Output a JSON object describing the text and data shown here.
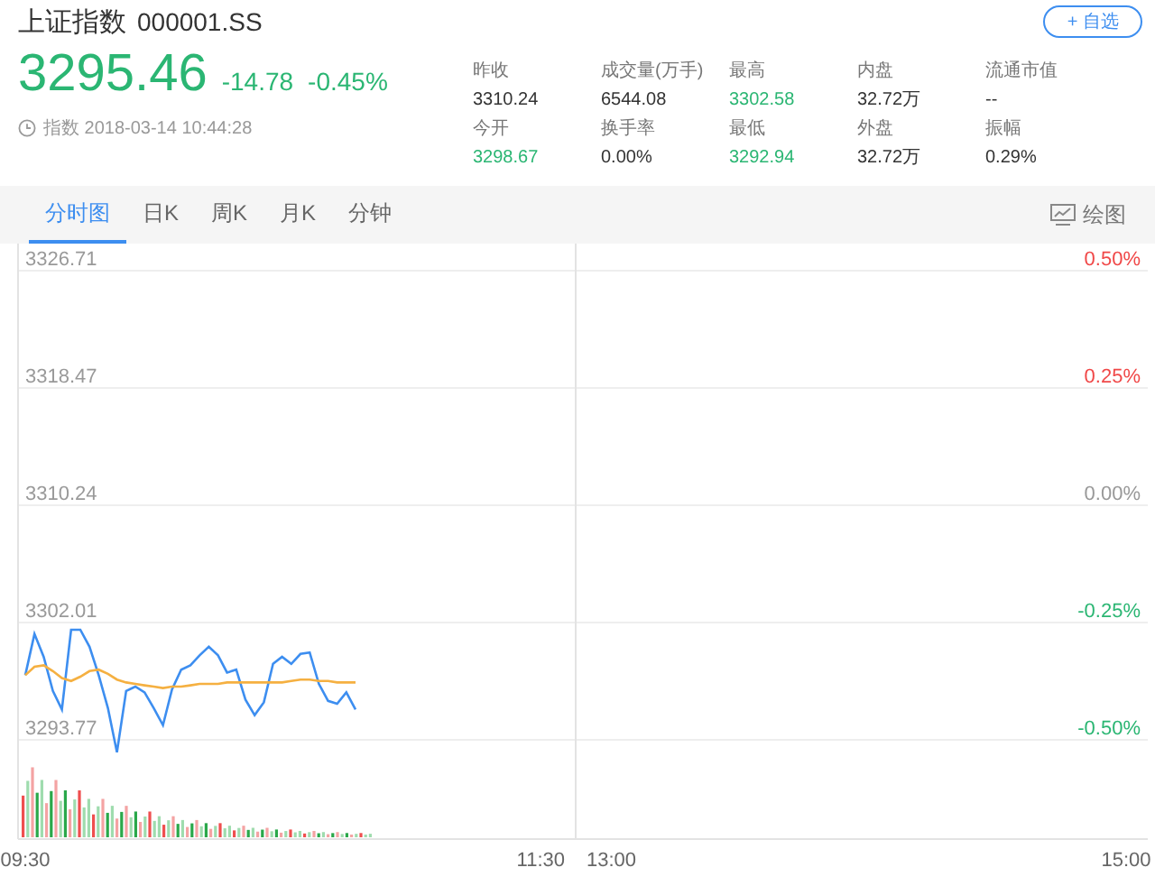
{
  "header": {
    "name": "上证指数",
    "code": "000001.SS",
    "watch_button": "+ 自选",
    "price": "3295.46",
    "change": "-14.78",
    "change_pct": "-0.45%",
    "color": "#2bb673",
    "timestamp": "指数 2018-03-14 10:44:28"
  },
  "stats": [
    {
      "label": "昨收",
      "value": "3310.24",
      "color": "#333333"
    },
    {
      "label": "成交量(万手)",
      "value": "6544.08",
      "color": "#333333"
    },
    {
      "label": "最高",
      "value": "3302.58",
      "color": "#2bb673"
    },
    {
      "label": "内盘",
      "value": "32.72万",
      "color": "#333333"
    },
    {
      "label": "流通市值",
      "value": "--",
      "color": "#333333"
    },
    {
      "label": "今开",
      "value": "3298.67",
      "color": "#2bb673"
    },
    {
      "label": "换手率",
      "value": "0.00%",
      "color": "#333333"
    },
    {
      "label": "最低",
      "value": "3292.94",
      "color": "#2bb673"
    },
    {
      "label": "外盘",
      "value": "32.72万",
      "color": "#333333"
    },
    {
      "label": "振幅",
      "value": "0.29%",
      "color": "#333333"
    }
  ],
  "tabs": [
    {
      "label": "分时图",
      "selected": true
    },
    {
      "label": "日K",
      "selected": false
    },
    {
      "label": "周K",
      "selected": false
    },
    {
      "label": "月K",
      "selected": false
    },
    {
      "label": "分钟",
      "selected": false
    }
  ],
  "draw_button": "绘图",
  "chart": {
    "percent_labels": [
      {
        "label": "0.50%",
        "color": "#f04848"
      },
      {
        "label": "0.25%",
        "color": "#f04848"
      },
      {
        "label": "0.00%",
        "color": "#999999"
      },
      {
        "label": "-0.25%",
        "color": "#2bb673"
      },
      {
        "label": "-0.50%",
        "color": "#2bb673"
      }
    ],
    "session_labels": [
      "11:30",
      "13:00"
    ],
    "chart_data": {
      "type": "line",
      "categories": [
        "09:30",
        null,
        null,
        null,
        null,
        null,
        null,
        null,
        null,
        null,
        null,
        null,
        null,
        null,
        null,
        null,
        null,
        null,
        null,
        null,
        null,
        null,
        null,
        null,
        null,
        null,
        null,
        null,
        null,
        null,
        null,
        null,
        null,
        null,
        null,
        null,
        null,
        null,
        null,
        null,
        null,
        null,
        null,
        null,
        null,
        null,
        null,
        null,
        null,
        null,
        null,
        null,
        null,
        null,
        null,
        null,
        null,
        null,
        null,
        null,
        null,
        null,
        null,
        null,
        null,
        null,
        null,
        null,
        null,
        null,
        null,
        null,
        null,
        null,
        null,
        null,
        null,
        null,
        null,
        null,
        null,
        null,
        null,
        null,
        null,
        null,
        null,
        null,
        null,
        null,
        null,
        null,
        null,
        null,
        null,
        null,
        null,
        null,
        null,
        null,
        null,
        null,
        null,
        null,
        null,
        null,
        null,
        null,
        null,
        null,
        null,
        null,
        null,
        null,
        null,
        null,
        null,
        null,
        null,
        null,
        "15:00"
      ],
      "series": [
        {
          "color": "#3d8ef0",
          "values": [
            3298.3,
            3301.2,
            3299.6,
            3297.2,
            3295.9,
            3301.5,
            3301.5,
            3300.3,
            3298.3,
            3296.0,
            3292.9,
            3297.2,
            3297.5,
            3297.1,
            3296.0,
            3294.8,
            3297.3,
            3298.7,
            3299.0,
            3299.7,
            3300.3,
            3299.7,
            3298.5,
            3298.7,
            3296.6,
            3295.5,
            3296.4,
            3299.1,
            3299.6,
            3299.1,
            3299.8,
            3299.9,
            3297.7,
            3296.5,
            3296.3,
            3297.1,
            3295.9,
            null,
            null,
            null,
            null,
            null,
            null,
            null,
            null,
            null,
            null,
            null,
            null,
            null,
            null,
            null,
            null,
            null,
            null,
            null,
            null,
            null,
            null,
            null,
            null,
            null,
            null,
            null,
            null,
            null,
            null,
            null,
            null,
            null,
            null,
            null,
            null,
            null,
            null,
            null,
            null,
            null,
            null,
            null,
            null,
            null,
            null,
            null,
            null,
            null,
            null,
            null,
            null,
            null,
            null,
            null,
            null,
            null,
            null,
            null,
            null,
            null,
            null,
            null,
            null,
            null,
            null,
            null,
            null,
            null,
            null,
            null,
            null,
            null,
            null,
            null,
            null,
            null,
            null,
            null,
            null,
            null,
            null,
            null,
            null
          ]
        },
        {
          "color": "#f5b041",
          "values": [
            3298.3,
            3298.9,
            3299.0,
            3298.6,
            3298.1,
            3297.9,
            3298.2,
            3298.6,
            3298.7,
            3298.4,
            3298.0,
            3297.8,
            3297.7,
            3297.6,
            3297.5,
            3297.4,
            3297.5,
            3297.5,
            3297.6,
            3297.7,
            3297.7,
            3297.7,
            3297.8,
            3297.8,
            3297.8,
            3297.8,
            3297.8,
            3297.8,
            3297.8,
            3297.9,
            3298.0,
            3298.0,
            3297.9,
            3297.9,
            3297.8,
            3297.8,
            3297.8,
            null,
            null,
            null,
            null,
            null,
            null,
            null,
            null,
            null,
            null,
            null,
            null,
            null,
            null,
            null,
            null,
            null,
            null,
            null,
            null,
            null,
            null,
            null,
            null,
            null,
            null,
            null,
            null,
            null,
            null,
            null,
            null,
            null,
            null,
            null,
            null,
            null,
            null,
            null,
            null,
            null,
            null,
            null,
            null,
            null,
            null,
            null,
            null,
            null,
            null,
            null,
            null,
            null,
            null,
            null,
            null,
            null,
            null,
            null,
            null,
            null,
            null,
            null,
            null,
            null,
            null,
            null,
            null,
            null,
            null,
            null,
            null,
            null,
            null,
            null,
            null,
            null,
            null,
            null,
            null,
            null,
            null,
            null,
            null
          ]
        }
      ],
      "grid": true,
      "ylim": [
        3286.8,
        3328.61
      ],
      "yticks": [
        {
          "value": 3326.71,
          "label": "3326.71"
        },
        {
          "value": 3318.47,
          "label": "3318.47"
        },
        {
          "value": 3310.24,
          "label": "3310.24"
        },
        {
          "value": 3302.01,
          "label": "3302.01"
        },
        {
          "value": 3293.77,
          "label": "3293.77"
        }
      ]
    }
  }
}
